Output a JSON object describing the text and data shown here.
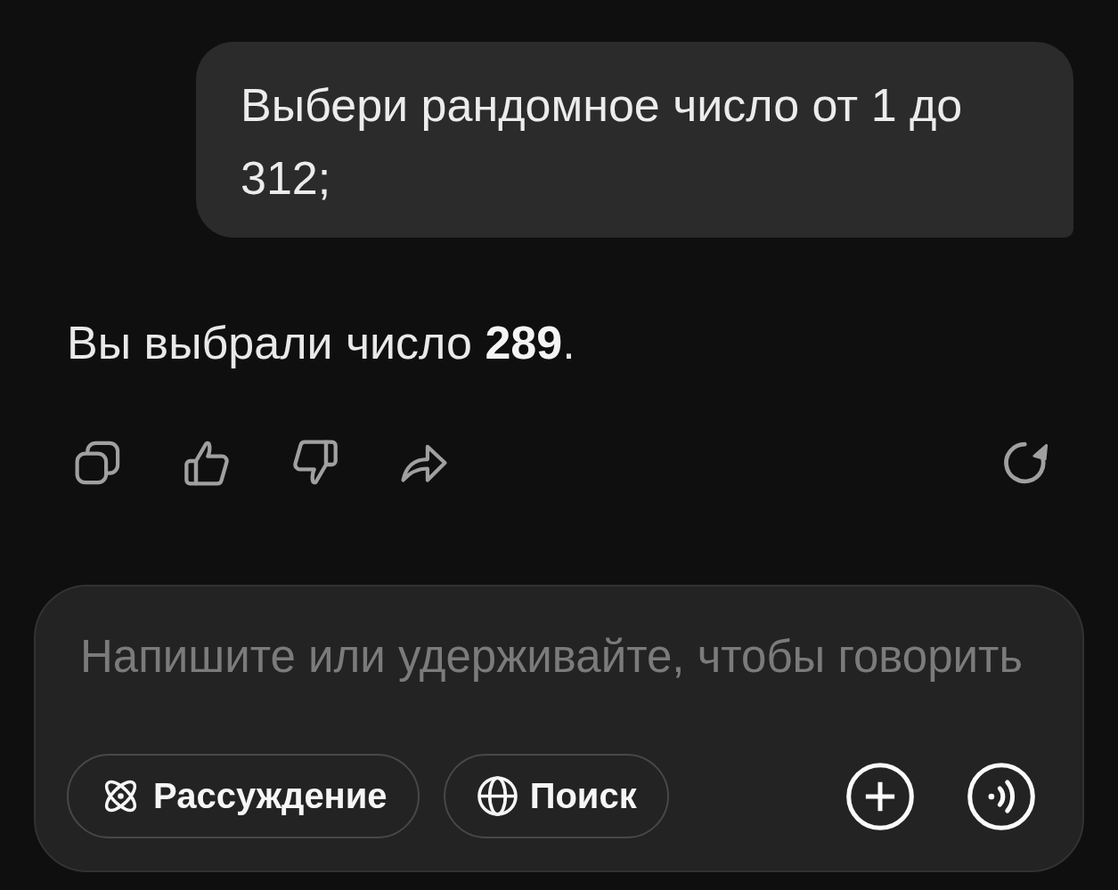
{
  "user_message": {
    "text": "Выбери рандомное число от 1 до 312;"
  },
  "assistant_reply": {
    "text": "Вы выбрали число **289**."
  },
  "composer": {
    "placeholder": "Напишите или удерживайте, чтобы говорить",
    "reasoning_chip": {
      "label": "Рассуждение"
    },
    "search_chip": {
      "label": "Поиск"
    }
  }
}
